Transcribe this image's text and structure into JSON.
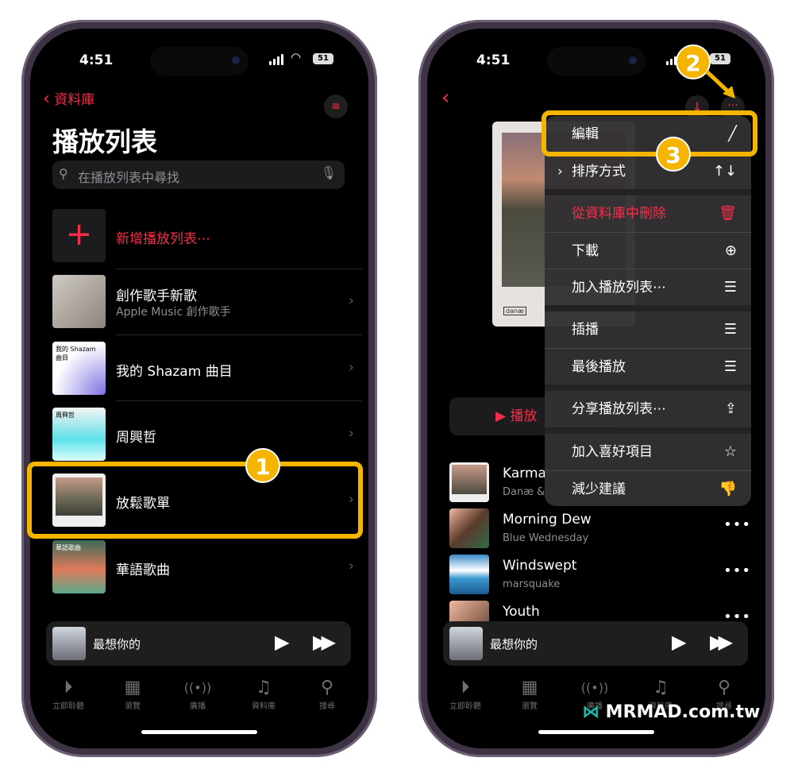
{
  "status": {
    "time": "4:51",
    "battery": "51"
  },
  "left": {
    "back_label": "資料庫",
    "title": "播放列表",
    "search_placeholder": "在播放列表中尋找",
    "new_playlist": "新增播放列表⋯",
    "playlists": [
      {
        "title": "創作歌手新歌",
        "subtitle": "Apple Music 創作歌手",
        "art_text": ""
      },
      {
        "title": "我的 Shazam 曲目",
        "subtitle": "",
        "art_text": "我的 Shazam 曲目"
      },
      {
        "title": "周興哲",
        "subtitle": "",
        "art_text": "周興哲"
      },
      {
        "title": "放鬆歌單",
        "subtitle": "",
        "art_text": ""
      },
      {
        "title": "華語歌曲",
        "subtitle": "",
        "art_text": "華語歌曲"
      }
    ]
  },
  "right": {
    "play_label": "播放",
    "menu": [
      {
        "label": "編輯",
        "icon": "pencil"
      },
      {
        "label": "排序方式",
        "icon": "sort-arrows"
      },
      {
        "label": "從資料庫中刪除",
        "icon": "trash",
        "destructive": true
      },
      {
        "label": "下載",
        "icon": "download-circle"
      },
      {
        "label": "加入播放列表⋯",
        "icon": "add-to-list"
      },
      {
        "label": "插播",
        "icon": "play-next"
      },
      {
        "label": "最後播放",
        "icon": "play-last"
      },
      {
        "label": "分享播放列表⋯",
        "icon": "share"
      },
      {
        "label": "加入喜好項目",
        "icon": "star"
      },
      {
        "label": "減少建議",
        "icon": "thumbs-down"
      }
    ],
    "songs": [
      {
        "title": "Karma",
        "artist": "Danæ &"
      },
      {
        "title": "Morning Dew",
        "artist": "Blue Wednesday"
      },
      {
        "title": "Windswept",
        "artist": "marsquake"
      },
      {
        "title": "Youth",
        "artist": ""
      }
    ],
    "art_label": "danæ"
  },
  "now_playing": {
    "title": "最想你的"
  },
  "tabs": [
    {
      "label": "立即聆聽",
      "icon": "play-circle"
    },
    {
      "label": "瀏覽",
      "icon": "grid"
    },
    {
      "label": "廣播",
      "icon": "radio"
    },
    {
      "label": "資料庫",
      "icon": "library",
      "active": true
    },
    {
      "label": "搜尋",
      "icon": "search"
    }
  ],
  "annotations": {
    "step1": "1",
    "step2": "2",
    "step3": "3"
  },
  "watermark": "MRMAD.com.tw",
  "colors": {
    "accent": "#fa2d48",
    "highlight": "#f5b400",
    "background": "#000000"
  }
}
